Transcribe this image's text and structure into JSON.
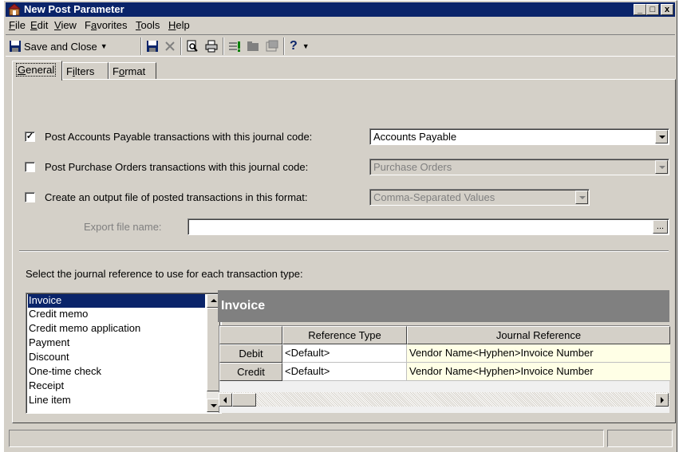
{
  "window": {
    "title": "New Post Parameter",
    "controls": [
      "_",
      "□",
      "x"
    ]
  },
  "menu": [
    {
      "label": "File",
      "accel": "F",
      "rest": "ile"
    },
    {
      "label": "Edit",
      "accel": "E",
      "rest": "dit"
    },
    {
      "label": "View",
      "accel": "V",
      "rest": "iew"
    },
    {
      "label": "Favorites",
      "pre": "F",
      "accel": "a",
      "rest": "vorites"
    },
    {
      "label": "Tools",
      "accel": "T",
      "rest": "ools"
    },
    {
      "label": "Help",
      "accel": "H",
      "rest": "elp"
    }
  ],
  "toolbar": {
    "save_close_label": "Save and Close",
    "help_label": "?"
  },
  "tabs": [
    {
      "label": "General",
      "accel": "G",
      "rest": "eneral"
    },
    {
      "label": "Filters",
      "pre": "F",
      "accel": "i",
      "rest": "lters"
    },
    {
      "label": "Format",
      "pre": "F",
      "accel": "o",
      "rest": "rmat"
    }
  ],
  "general": {
    "ap_checked": true,
    "ap_label": "Post Accounts Payable transactions with this journal code:",
    "ap_value": "Accounts Payable",
    "po_checked": false,
    "po_label": "Post Purchase Orders transactions with this journal code:",
    "po_value": "Purchase Orders",
    "out_checked": false,
    "out_label": "Create an output file of posted transactions in this format:",
    "out_value": "Comma-Separated Values",
    "export_label": "Export file name:",
    "export_value": "",
    "ellipsis": "...",
    "select_label": "Select the journal reference to use for each transaction type:"
  },
  "transaction_types": [
    "Invoice",
    "Credit memo",
    "Credit memo application",
    "Payment",
    "Discount",
    "One-time check",
    "Receipt",
    "Line item"
  ],
  "selected_type": "Invoice",
  "detail": {
    "header": "Invoice",
    "columns": [
      "Reference Type",
      "Journal Reference"
    ],
    "rows": [
      {
        "label": "Debit",
        "reference_type": "<Default>",
        "journal_reference": "Vendor Name<Hyphen>Invoice Number"
      },
      {
        "label": "Credit",
        "reference_type": "<Default>",
        "journal_reference": "Vendor Name<Hyphen>Invoice Number"
      }
    ]
  },
  "colors": {
    "titlebar": "#0a246a",
    "face": "#d4d0c8",
    "selection": "#0a246a",
    "journal_cell": "#ffffe6"
  }
}
